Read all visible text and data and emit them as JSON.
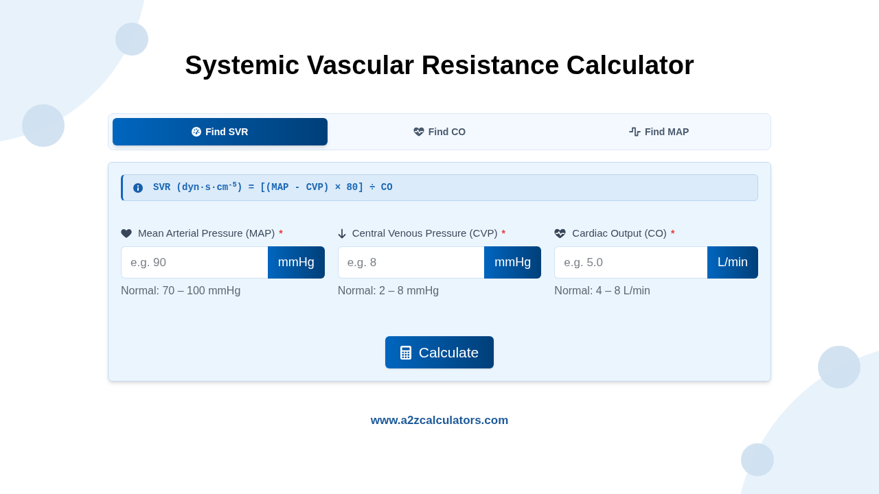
{
  "title": "Systemic Vascular Resistance Calculator",
  "tabs": [
    {
      "label": "Find SVR",
      "selected": true
    },
    {
      "label": "Find CO",
      "selected": false
    },
    {
      "label": "Find MAP",
      "selected": false
    }
  ],
  "formula": {
    "text": "SVR (dyn·s·cm$^{-5}$) = [(MAP - CVP) × 80] ÷ CO"
  },
  "fields": [
    {
      "label": "Mean Arterial Pressure (MAP)",
      "required_mark": "*",
      "placeholder": "e.g. 90",
      "unit": "mmHg",
      "hint": "Normal: 70 – 100 mmHg"
    },
    {
      "label": "Central Venous Pressure (CVP)",
      "required_mark": "*",
      "placeholder": "e.g. 8",
      "unit": "mmHg",
      "hint": "Normal: 2 – 8 mmHg"
    },
    {
      "label": "Cardiac Output (CO)",
      "required_mark": "*",
      "placeholder": "e.g. 5.0",
      "unit": "L/min",
      "hint": "Normal: 4 – 8 L/min"
    }
  ],
  "calculate_button": {
    "label": "Calculate"
  },
  "footer": {
    "url": "www.a2zcalculators.com"
  }
}
